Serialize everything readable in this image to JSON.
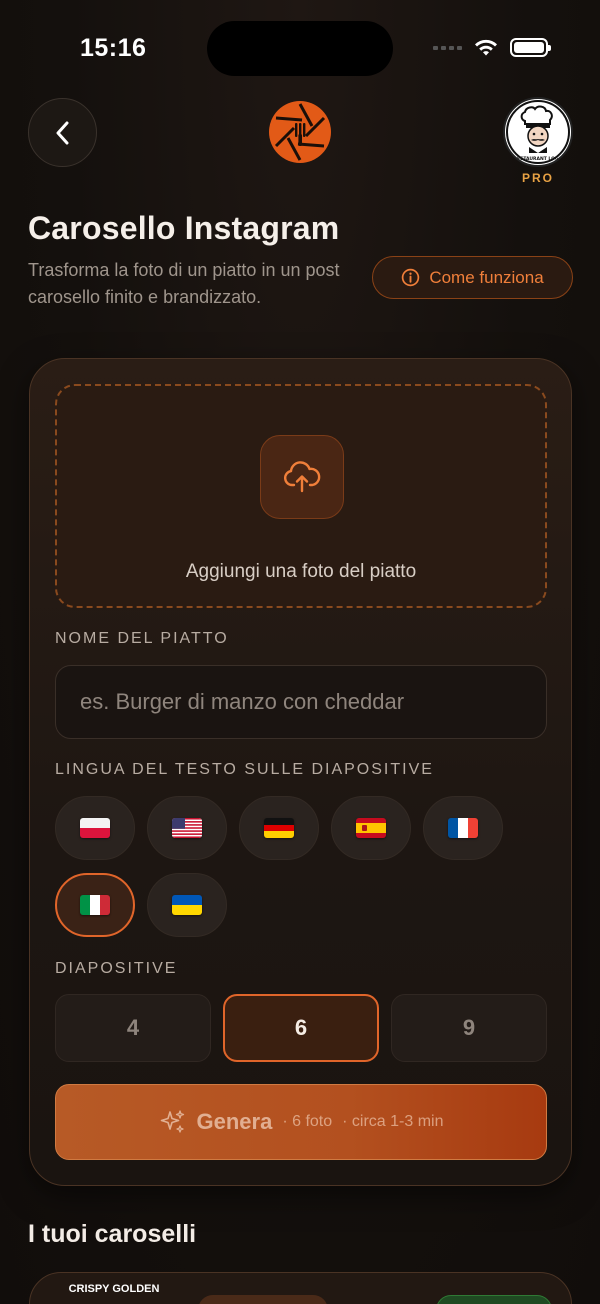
{
  "status_bar": {
    "time": "15:16"
  },
  "header": {
    "back_icon": "chevron-left-icon",
    "logo_icon": "camera-aperture-fork-icon",
    "badge": "PRO"
  },
  "page": {
    "title": "Carosello Instagram",
    "subtitle": "Trasforma la foto di un piatto in un post carosello finito e brandizzato.",
    "how_it_works": "Come funziona"
  },
  "form": {
    "upload_label": "Aggiungi una foto del piatto",
    "dish_name_label": "NOME DEL PIATTO",
    "dish_name_placeholder": "es. Burger di manzo con cheddar",
    "dish_name_value": "",
    "language_label": "LINGUA DEL TESTO SULLE DIAPOSITIVE",
    "languages": [
      {
        "code": "pl",
        "icon": "flag-poland-icon",
        "selected": false
      },
      {
        "code": "us",
        "icon": "flag-usa-icon",
        "selected": false
      },
      {
        "code": "de",
        "icon": "flag-germany-icon",
        "selected": false
      },
      {
        "code": "es",
        "icon": "flag-spain-icon",
        "selected": false
      },
      {
        "code": "fr",
        "icon": "flag-france-icon",
        "selected": false
      },
      {
        "code": "it",
        "icon": "flag-italy-icon",
        "selected": true
      },
      {
        "code": "ua",
        "icon": "flag-ukraine-icon",
        "selected": false
      }
    ],
    "slides_label": "DIAPOSITIVE",
    "slide_options": [
      "4",
      "6",
      "9"
    ],
    "slides_selected": "6",
    "generate": {
      "label": "Genera",
      "photos": "· 6 foto",
      "time": "· circa 1-3 min"
    }
  },
  "history": {
    "title": "I tuoi caroselli",
    "first_item_thumb_text": "CRISPY GOLDEN"
  },
  "colors": {
    "accent": "#e0652a",
    "background": "#14100d",
    "pro": "#e8a244"
  }
}
